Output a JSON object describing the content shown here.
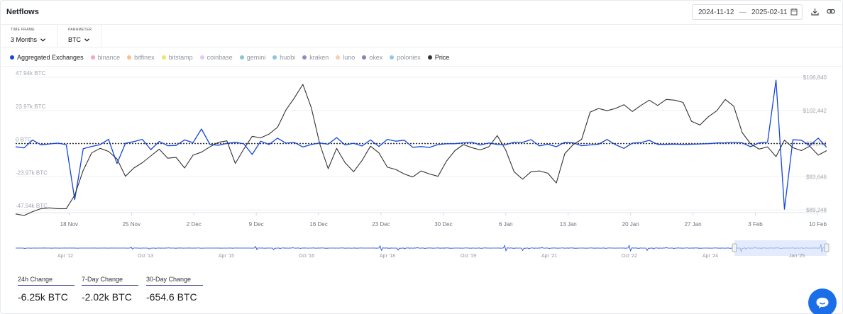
{
  "header": {
    "title": "Netflows",
    "date_start": "2024-11-12",
    "date_separator": "—",
    "date_end": "2025-02-11",
    "calendar_icon": "calendar-icon",
    "download_icon": "download-icon",
    "link_icon": "link-icon"
  },
  "controls": {
    "timeframe": {
      "label": "TIME FRAME",
      "value": "3 Months"
    },
    "parameter": {
      "label": "PARAMETER",
      "value": "BTC"
    }
  },
  "legend": [
    {
      "label": "Aggregated Exchanges",
      "color": "#1346dd",
      "active": true
    },
    {
      "label": "binance",
      "color": "#f5a3c7",
      "active": false
    },
    {
      "label": "bitfinex",
      "color": "#f8c28a",
      "active": false
    },
    {
      "label": "bitstamp",
      "color": "#f2e36d",
      "active": false
    },
    {
      "label": "coinbase",
      "color": "#e6c7f5",
      "active": false
    },
    {
      "label": "gemini",
      "color": "#8ec3d6",
      "active": false
    },
    {
      "label": "huobi",
      "color": "#8fc2e0",
      "active": false
    },
    {
      "label": "kraken",
      "color": "#9a86c4",
      "active": false
    },
    {
      "label": "luno",
      "color": "#f5cfb0",
      "active": false
    },
    {
      "label": "okex",
      "color": "#8c7fb8",
      "active": false
    },
    {
      "label": "poloniex",
      "color": "#8ccbe8",
      "active": false
    },
    {
      "label": "Price",
      "color": "#333333",
      "active": true
    }
  ],
  "chart_data": {
    "type": "line",
    "x_ticks": [
      "18 Nov",
      "25 Nov",
      "2 Dec",
      "9 Dec",
      "16 Dec",
      "23 Dec",
      "30 Dec",
      "6 Jan",
      "13 Jan",
      "20 Jan",
      "27 Jan",
      "3 Feb",
      "10 Feb"
    ],
    "x_range": [
      "2024-11-12",
      "2025-02-11"
    ],
    "y_left": {
      "ticks": [
        "47.94k BTC",
        "23.97k BTC",
        "0 BTC",
        "-23.97k BTC",
        "-47.94k BTC"
      ],
      "range": [
        -47940,
        47940
      ]
    },
    "y_right": {
      "ticks": [
        "$106,840",
        "$102,442",
        "$98,044",
        "$93,646",
        "$89,248"
      ],
      "range": [
        89248,
        106840
      ]
    },
    "zero_line": true,
    "series": [
      {
        "name": "Aggregated Exchanges",
        "axis": "left",
        "color": "#1346dd",
        "values": [
          -2300,
          -3200,
          2500,
          -900,
          -300,
          300,
          -800,
          -40600,
          -3700,
          -2100,
          -800,
          3000,
          -14500,
          200,
          1400,
          3000,
          -4400,
          1500,
          -1600,
          -1400,
          2600,
          600,
          10500,
          -600,
          -1300,
          100,
          900,
          -200,
          -7900,
          1700,
          -700,
          3900,
          300,
          800,
          -2500,
          -700,
          400,
          -500,
          4300,
          -1000,
          200,
          -1800,
          2600,
          -2100,
          3000,
          1700,
          2400,
          -2700,
          -2200,
          -2800,
          -700,
          -200,
          -100,
          500,
          1000,
          -1100,
          400,
          -700,
          -900,
          1000,
          800,
          2800,
          -1700,
          -500,
          -2300,
          900,
          500,
          -1600,
          -1000,
          -500,
          2900,
          -800,
          -3500,
          300,
          700,
          2300,
          -600,
          -600,
          -400,
          -700,
          -500,
          -300,
          -100,
          400,
          500,
          800,
          500,
          -2300,
          500,
          1000,
          45800,
          -47500,
          2700,
          2400,
          -1500,
          3900,
          -2800
        ],
        "note_none": ""
      },
      {
        "name": "Price",
        "axis": "right",
        "color": "#333333",
        "values": [
          88700,
          88500,
          89000,
          89400,
          89500,
          89400,
          89400,
          91200,
          94500,
          96800,
          97400,
          97000,
          96000,
          93700,
          94800,
          95500,
          96400,
          97300,
          96100,
          96200,
          94800,
          96500,
          96900,
          97600,
          98200,
          98400,
          95400,
          97300,
          99000,
          98800,
          99300,
          100200,
          102500,
          104100,
          105900,
          102800,
          98000,
          94700,
          97400,
          95500,
          94300,
          95800,
          97700,
          96800,
          94900,
          94600,
          94000,
          93600,
          94400,
          94000,
          93700,
          95700,
          97100,
          97900,
          97500,
          97200,
          97600,
          99100,
          97200,
          94300,
          93300,
          94300,
          94400,
          94100,
          92800,
          96700,
          97900,
          98600,
          102200,
          102700,
          102400,
          102700,
          103200,
          102300,
          103100,
          103800,
          103100,
          103900,
          103800,
          103500,
          101000,
          100500,
          101600,
          102400,
          103900,
          103000,
          99500,
          98000,
          97300,
          97600,
          96300,
          98500,
          97500,
          97100,
          97700,
          96500,
          97100
        ]
      }
    ],
    "navigator_ticks": [
      "Apr '12",
      "Oct '13",
      "Apr '15",
      "Oct '16",
      "Apr '18",
      "Oct '19",
      "Apr '21",
      "Oct '22",
      "Apr '24",
      "Jan '25"
    ]
  },
  "stats": [
    {
      "label": "24h Change",
      "value": "-6.25k BTC"
    },
    {
      "label": "7-Day Change",
      "value": "-2.02k BTC"
    },
    {
      "label": "30-Day Change",
      "value": "-654.6 BTC"
    }
  ],
  "chat": {
    "icon": "chat-bubble-icon"
  }
}
